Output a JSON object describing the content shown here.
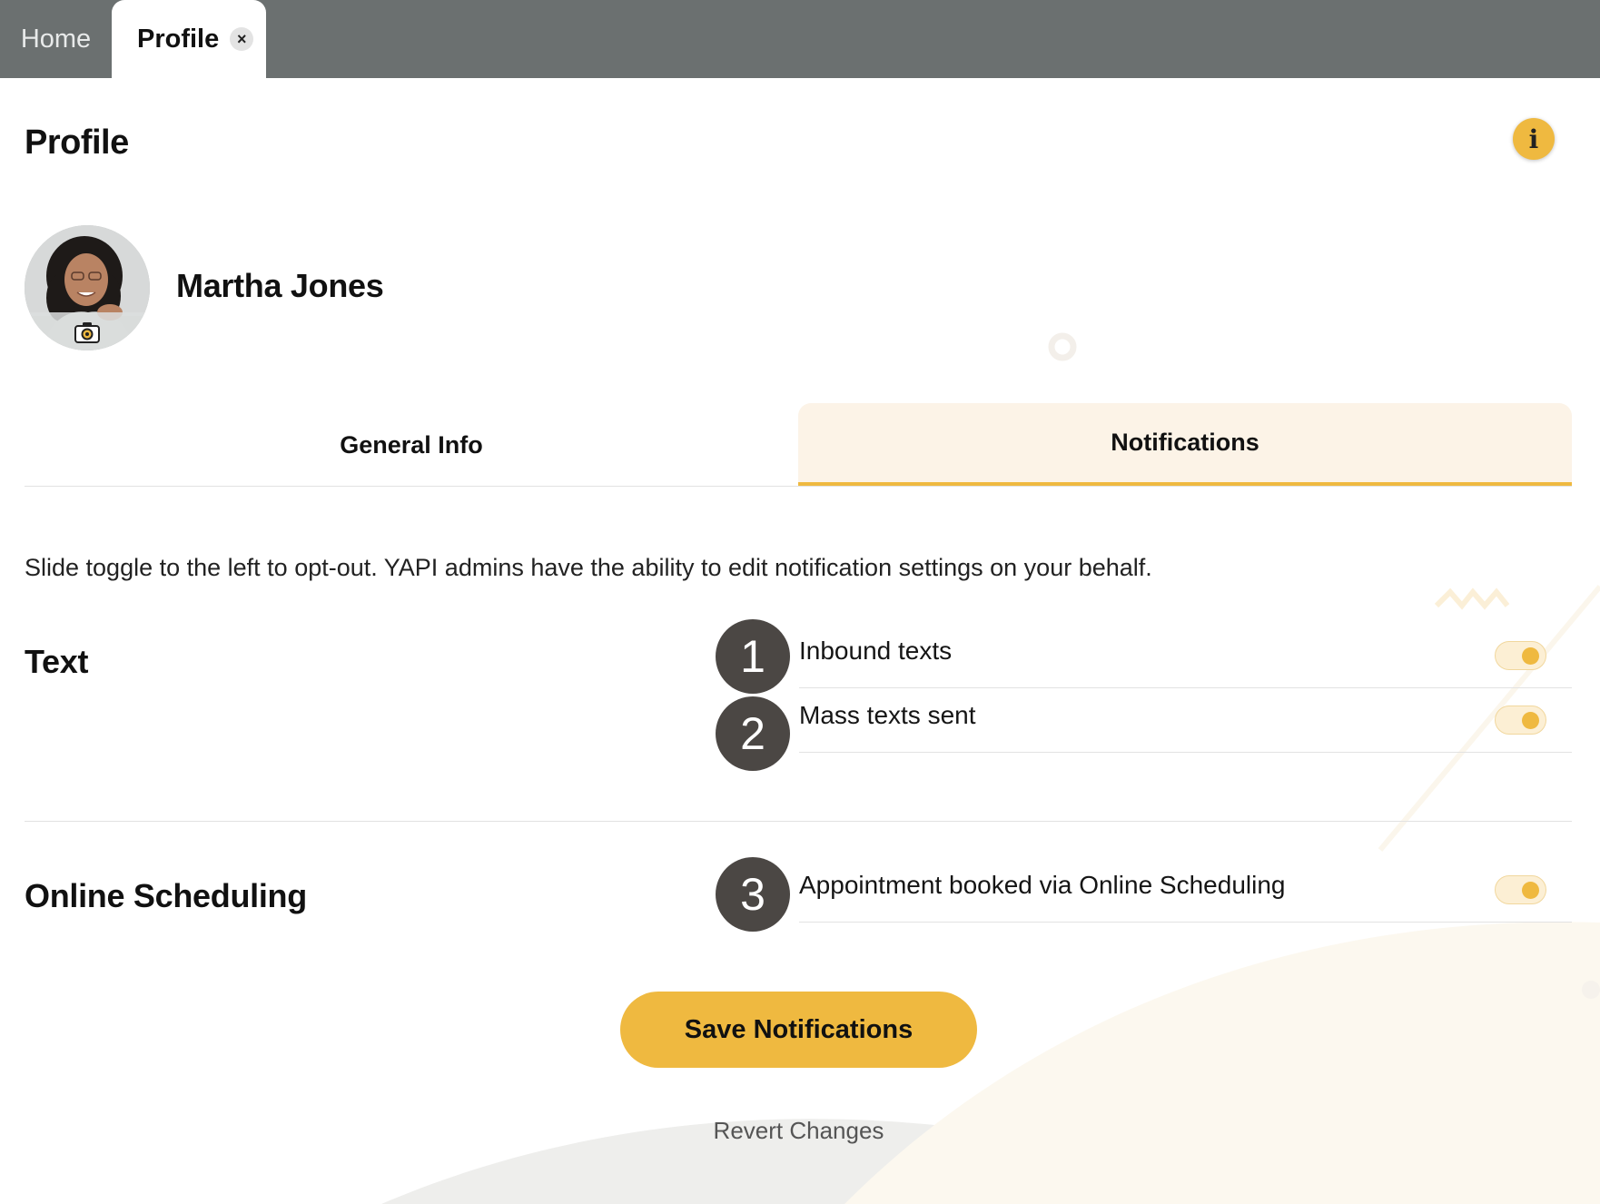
{
  "topbar": {
    "tabs": [
      {
        "label": "Home",
        "active": false
      },
      {
        "label": "Profile",
        "active": true,
        "closable": true
      }
    ],
    "close_glyph": "×"
  },
  "header": {
    "title": "Profile",
    "info_icon": "info-icon",
    "info_glyph": "i"
  },
  "user": {
    "name": "Martha Jones",
    "avatar_icon": "avatar-photo",
    "camera_icon": "camera-icon"
  },
  "section_tabs": [
    {
      "label": "General Info",
      "active": false
    },
    {
      "label": "Notifications",
      "active": true
    }
  ],
  "helper_text": "Slide toggle to the left to opt-out. YAPI admins have the ability to edit notification settings on your behalf.",
  "groups": [
    {
      "title": "Text",
      "items": [
        {
          "step": "1",
          "label": "Inbound texts",
          "enabled": true
        },
        {
          "step": "2",
          "label": "Mass texts sent",
          "enabled": true
        }
      ]
    },
    {
      "title": "Online Scheduling",
      "items": [
        {
          "step": "3",
          "label": "Appointment booked via Online Scheduling",
          "enabled": true
        }
      ]
    }
  ],
  "actions": {
    "save_label": "Save Notifications",
    "revert_label": "Revert Changes"
  },
  "colors": {
    "accent": "#efb940",
    "topbar": "#6b7070",
    "active_tab_bg": "#fcf3e7",
    "badge": "#4b4744"
  }
}
